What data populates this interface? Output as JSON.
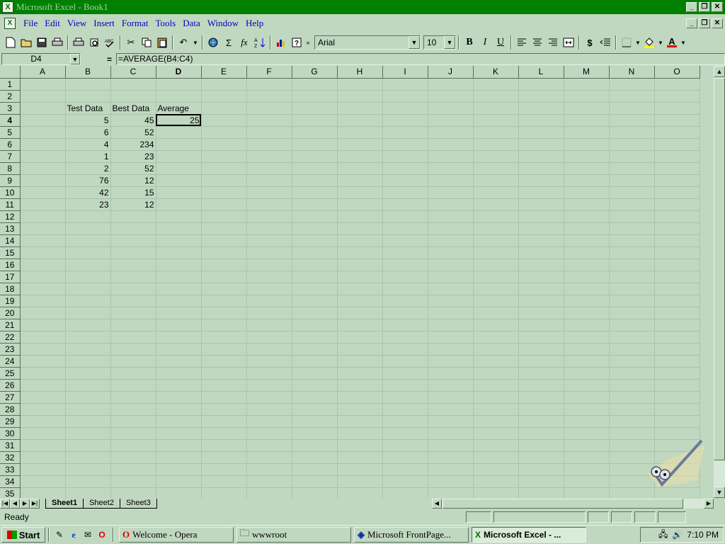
{
  "window": {
    "title": "Microsoft Excel - Book1"
  },
  "menu": [
    "File",
    "Edit",
    "View",
    "Insert",
    "Format",
    "Tools",
    "Data",
    "Window",
    "Help"
  ],
  "toolbar": {
    "icons": [
      "new-icon",
      "open-icon",
      "save-icon",
      "print-icon",
      "print-preview-icon",
      "spelling-icon",
      "cut-icon",
      "copy-icon",
      "paste-icon",
      "format-painter-icon",
      "undo-icon",
      "web-icon",
      "autosum-icon",
      "paste-function-icon",
      "sort-icon",
      "chart-wizard-icon",
      "help-icon"
    ],
    "autosum_glyph": "Σ",
    "fx_glyph": "fx",
    "font": "Arial",
    "size": "10",
    "bold": "B",
    "italic": "I",
    "underline": "U",
    "currency": "$",
    "font_color_letter": "A"
  },
  "formula_bar": {
    "name_box": "D4",
    "equals": "=",
    "formula": "=AVERAGE(B4:C4)"
  },
  "sheet": {
    "columns": [
      "A",
      "B",
      "C",
      "D",
      "E",
      "F",
      "G",
      "H",
      "I",
      "J",
      "K",
      "L",
      "M",
      "N",
      "O"
    ],
    "active_col": "D",
    "active_row": 4,
    "row_count": 35,
    "cells": {
      "B3": "Test Data",
      "C3": "Best Data",
      "D3": "Average",
      "B4": "5",
      "C4": "45",
      "D4": "25",
      "B5": "6",
      "C5": "52",
      "B6": "4",
      "C6": "234",
      "B7": "1",
      "C7": "23",
      "B8": "2",
      "C8": "52",
      "B9": "76",
      "C9": "12",
      "B10": "42",
      "C10": "15",
      "B11": "23",
      "C11": "12"
    }
  },
  "sheet_tabs": [
    "Sheet1",
    "Sheet2",
    "Sheet3"
  ],
  "active_sheet": "Sheet1",
  "status": "Ready",
  "taskbar": {
    "start": "Start",
    "tasks": [
      "Welcome - Opera",
      "wwwroot",
      "Microsoft FrontPage...",
      "Microsoft Excel - ..."
    ],
    "active_task": 3,
    "time": "7:10 PM"
  },
  "colors": {
    "titlebar": "#008000",
    "window": "#c0d8c0",
    "menu_text": "#0000c0",
    "gridline": "#a8c4a8"
  }
}
